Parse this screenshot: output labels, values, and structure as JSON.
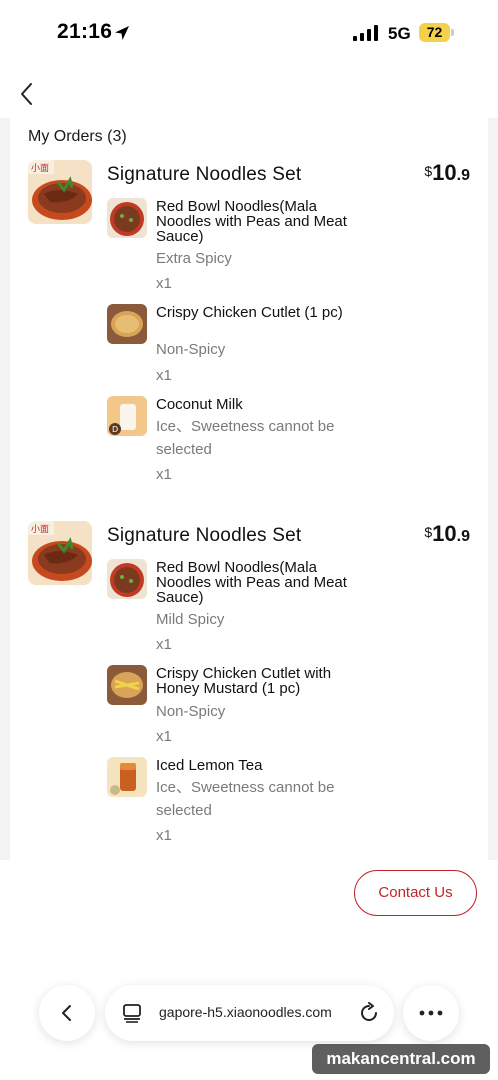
{
  "status_bar": {
    "time": "21:16",
    "network": "5G",
    "battery": "72"
  },
  "orders_title": "My Orders (3)",
  "orders": [
    {
      "name": "Signature Noodles Set",
      "price_currency": "$",
      "price_int": "10",
      "price_dec": ".9",
      "items": [
        {
          "name": "Red Bowl Noodles(Mala Noodles with Peas and Meat Sauce)",
          "option": "Extra Spicy",
          "qty": "x1"
        },
        {
          "name": "Crispy Chicken Cutlet (1 pc)",
          "option": "Non-Spicy",
          "qty": "x1"
        },
        {
          "name": "Coconut Milk",
          "option": "Ice、Sweetness cannot be selected",
          "qty": "x1"
        }
      ]
    },
    {
      "name": "Signature Noodles Set",
      "price_currency": "$",
      "price_int": "10",
      "price_dec": ".9",
      "items": [
        {
          "name": "Red Bowl Noodles(Mala Noodles with Peas and Meat Sauce)",
          "option": "Mild Spicy",
          "qty": "x1"
        },
        {
          "name": "Crispy Chicken Cutlet with Honey Mustard (1 pc)",
          "option": "Non-Spicy",
          "qty": "x1"
        },
        {
          "name": "Iced Lemon Tea",
          "option": "Ice、Sweetness cannot be selected",
          "qty": "x1"
        }
      ]
    }
  ],
  "contact_label": "Contact Us",
  "browser": {
    "url": "gapore-h5.xiaonoodles.com"
  },
  "watermark": "makancentral.com",
  "colors": {
    "accent": "#c0262c",
    "battery": "#f5d14a",
    "text_secondary": "#7a7a7a"
  },
  "icons": [
    "location-arrow-icon",
    "signal-icon",
    "battery-icon",
    "back-chevron-icon",
    "tabs-icon",
    "reload-icon",
    "more-icon"
  ]
}
